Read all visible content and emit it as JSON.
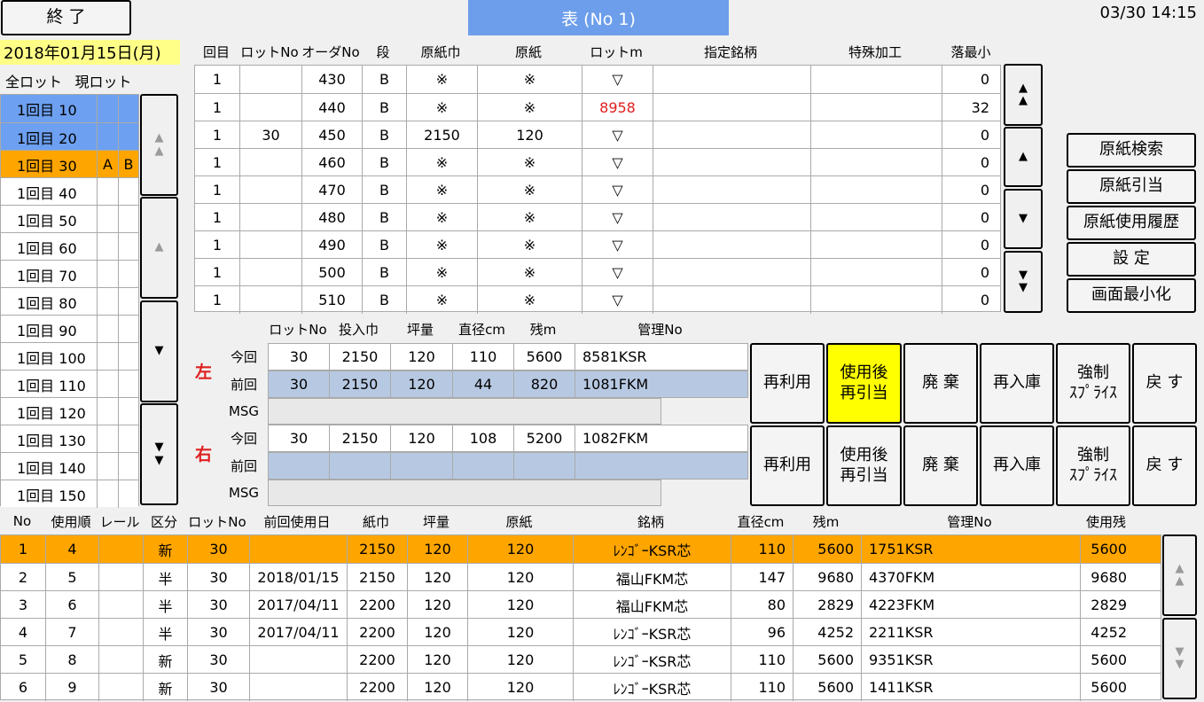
{
  "header": {
    "exit_label": "終 了",
    "title": "表 (No 1)",
    "datetime": "03/30 14:15",
    "date_label": "2018年01月15日(月)"
  },
  "lot_tabs": [
    "全ロット",
    "現ロット"
  ],
  "lot_list": [
    {
      "round": "1回目",
      "no": "10",
      "a": "",
      "b": "",
      "state": "selected"
    },
    {
      "round": "1回目",
      "no": "20",
      "a": "",
      "b": "",
      "state": "selected"
    },
    {
      "round": "1回目",
      "no": "30",
      "a": "A",
      "b": "B",
      "state": "current"
    },
    {
      "round": "1回目",
      "no": "40",
      "a": "",
      "b": "",
      "state": ""
    },
    {
      "round": "1回目",
      "no": "50",
      "a": "",
      "b": "",
      "state": ""
    },
    {
      "round": "1回目",
      "no": "60",
      "a": "",
      "b": "",
      "state": ""
    },
    {
      "round": "1回目",
      "no": "70",
      "a": "",
      "b": "",
      "state": ""
    },
    {
      "round": "1回目",
      "no": "80",
      "a": "",
      "b": "",
      "state": ""
    },
    {
      "round": "1回目",
      "no": "90",
      "a": "",
      "b": "",
      "state": ""
    },
    {
      "round": "1回目",
      "no": "100",
      "a": "",
      "b": "",
      "state": ""
    },
    {
      "round": "1回目",
      "no": "110",
      "a": "",
      "b": "",
      "state": ""
    },
    {
      "round": "1回目",
      "no": "120",
      "a": "",
      "b": "",
      "state": ""
    },
    {
      "round": "1回目",
      "no": "130",
      "a": "",
      "b": "",
      "state": ""
    },
    {
      "round": "1回目",
      "no": "140",
      "a": "",
      "b": "",
      "state": ""
    },
    {
      "round": "1回目",
      "no": "150",
      "a": "",
      "b": "",
      "state": ""
    }
  ],
  "order_table": {
    "headers": [
      "回目",
      "ロットNo",
      "オーダNo",
      "段",
      "原紙巾",
      "原紙",
      "ロットm",
      "指定銘柄",
      "特殊加工",
      "落最小"
    ],
    "rows": [
      {
        "kaime": "1",
        "lot": "",
        "order": "430",
        "dan": "B",
        "haba": "※",
        "genshi": "※",
        "lotm": "▽",
        "lotm_red": false,
        "meigara": "",
        "kakou": "",
        "min": "0"
      },
      {
        "kaime": "1",
        "lot": "",
        "order": "440",
        "dan": "B",
        "haba": "※",
        "genshi": "※",
        "lotm": "8958",
        "lotm_red": true,
        "meigara": "",
        "kakou": "",
        "min": "32"
      },
      {
        "kaime": "1",
        "lot": "30",
        "order": "450",
        "dan": "B",
        "haba": "2150",
        "genshi": "120",
        "lotm": "▽",
        "lotm_red": false,
        "meigara": "",
        "kakou": "",
        "min": "0"
      },
      {
        "kaime": "1",
        "lot": "",
        "order": "460",
        "dan": "B",
        "haba": "※",
        "genshi": "※",
        "lotm": "▽",
        "lotm_red": false,
        "meigara": "",
        "kakou": "",
        "min": "0"
      },
      {
        "kaime": "1",
        "lot": "",
        "order": "470",
        "dan": "B",
        "haba": "※",
        "genshi": "※",
        "lotm": "▽",
        "lotm_red": false,
        "meigara": "",
        "kakou": "",
        "min": "0"
      },
      {
        "kaime": "1",
        "lot": "",
        "order": "480",
        "dan": "B",
        "haba": "※",
        "genshi": "※",
        "lotm": "▽",
        "lotm_red": false,
        "meigara": "",
        "kakou": "",
        "min": "0"
      },
      {
        "kaime": "1",
        "lot": "",
        "order": "490",
        "dan": "B",
        "haba": "※",
        "genshi": "※",
        "lotm": "▽",
        "lotm_red": false,
        "meigara": "",
        "kakou": "",
        "min": "0"
      },
      {
        "kaime": "1",
        "lot": "",
        "order": "500",
        "dan": "B",
        "haba": "※",
        "genshi": "※",
        "lotm": "▽",
        "lotm_red": false,
        "meigara": "",
        "kakou": "",
        "min": "0"
      },
      {
        "kaime": "1",
        "lot": "",
        "order": "510",
        "dan": "B",
        "haba": "※",
        "genshi": "※",
        "lotm": "▽",
        "lotm_red": false,
        "meigara": "",
        "kakou": "",
        "min": "0"
      }
    ]
  },
  "side_buttons": [
    "原紙検索",
    "原紙引当",
    "原紙使用履歴",
    "設 定",
    "画面最小化"
  ],
  "roll_panel": {
    "headers": [
      "ロットNo",
      "投入巾",
      "坪量",
      "直径cm",
      "残m",
      "管理No"
    ],
    "left_label": "左",
    "right_label": "右",
    "row_labels": {
      "current": "今回",
      "previous": "前回",
      "msg": "MSG"
    },
    "left": {
      "current": [
        "30",
        "2150",
        "120",
        "110",
        "5600",
        "8581KSR"
      ],
      "previous": [
        "30",
        "2150",
        "120",
        "44",
        "820",
        "1081FKM"
      ],
      "msg": ""
    },
    "right": {
      "current": [
        "30",
        "2150",
        "120",
        "108",
        "5200",
        "1082FKM"
      ],
      "previous": [
        "",
        "",
        "",
        "",
        "",
        ""
      ],
      "msg": ""
    }
  },
  "action_buttons": {
    "reuse": "再利用",
    "after_use_1": "使用後",
    "after_use_2": "再引当",
    "discard": "廃 棄",
    "restock": "再入庫",
    "force_1": "強制",
    "force_2": "ｽﾌﾟﾗｲｽ",
    "back": "戻 す"
  },
  "usage_table": {
    "headers": [
      "No",
      "使用順",
      "レール",
      "区分",
      "ロットNo",
      "前回使用日",
      "紙巾",
      "坪量",
      "原紙",
      "銘柄",
      "直径cm",
      "残m",
      "管理No",
      "使用残"
    ],
    "rows": [
      {
        "no": "1",
        "order": "4",
        "rail": "",
        "kubun": "新",
        "lot": "30",
        "prev_date": "",
        "width": "2150",
        "basis": "120",
        "genshi": "120",
        "brand": "ﾚﾝｺﾞｰKSR芯",
        "dia": "110",
        "remain": "5600",
        "kanri": "1751KSR",
        "use_remain": "5600",
        "highlight": true
      },
      {
        "no": "2",
        "order": "5",
        "rail": "",
        "kubun": "半",
        "lot": "30",
        "prev_date": "2018/01/15",
        "width": "2150",
        "basis": "120",
        "genshi": "120",
        "brand": "福山FKM芯",
        "dia": "147",
        "remain": "9680",
        "kanri": "4370FKM",
        "use_remain": "9680",
        "highlight": false
      },
      {
        "no": "3",
        "order": "6",
        "rail": "",
        "kubun": "半",
        "lot": "30",
        "prev_date": "2017/04/11",
        "width": "2200",
        "basis": "120",
        "genshi": "120",
        "brand": "福山FKM芯",
        "dia": "80",
        "remain": "2829",
        "kanri": "4223FKM",
        "use_remain": "2829",
        "highlight": false
      },
      {
        "no": "4",
        "order": "7",
        "rail": "",
        "kubun": "半",
        "lot": "30",
        "prev_date": "2017/04/11",
        "width": "2200",
        "basis": "120",
        "genshi": "120",
        "brand": "ﾚﾝｺﾞｰKSR芯",
        "dia": "96",
        "remain": "4252",
        "kanri": "2211KSR",
        "use_remain": "4252",
        "highlight": false
      },
      {
        "no": "5",
        "order": "8",
        "rail": "",
        "kubun": "新",
        "lot": "30",
        "prev_date": "",
        "width": "2200",
        "basis": "120",
        "genshi": "120",
        "brand": "ﾚﾝｺﾞｰKSR芯",
        "dia": "110",
        "remain": "5600",
        "kanri": "9351KSR",
        "use_remain": "5600",
        "highlight": false
      },
      {
        "no": "6",
        "order": "9",
        "rail": "",
        "kubun": "新",
        "lot": "30",
        "prev_date": "",
        "width": "2200",
        "basis": "120",
        "genshi": "120",
        "brand": "ﾚﾝｺﾞｰKSR芯",
        "dia": "110",
        "remain": "5600",
        "kanri": "1411KSR",
        "use_remain": "5600",
        "highlight": false
      }
    ]
  },
  "colors": {
    "selected": "#6da0f0",
    "current": "#ffa500",
    "date_bg": "#ffff88",
    "title_bg": "#6d9eeb",
    "highlight_button": "#ffff00",
    "previous_row": "#b7c9e2",
    "warning_text": "#e02020"
  },
  "icons": {
    "scroll_top": "double-up-arrow-icon",
    "scroll_up": "up-arrow-icon",
    "scroll_down": "down-arrow-icon",
    "scroll_bottom": "double-down-arrow-icon"
  }
}
